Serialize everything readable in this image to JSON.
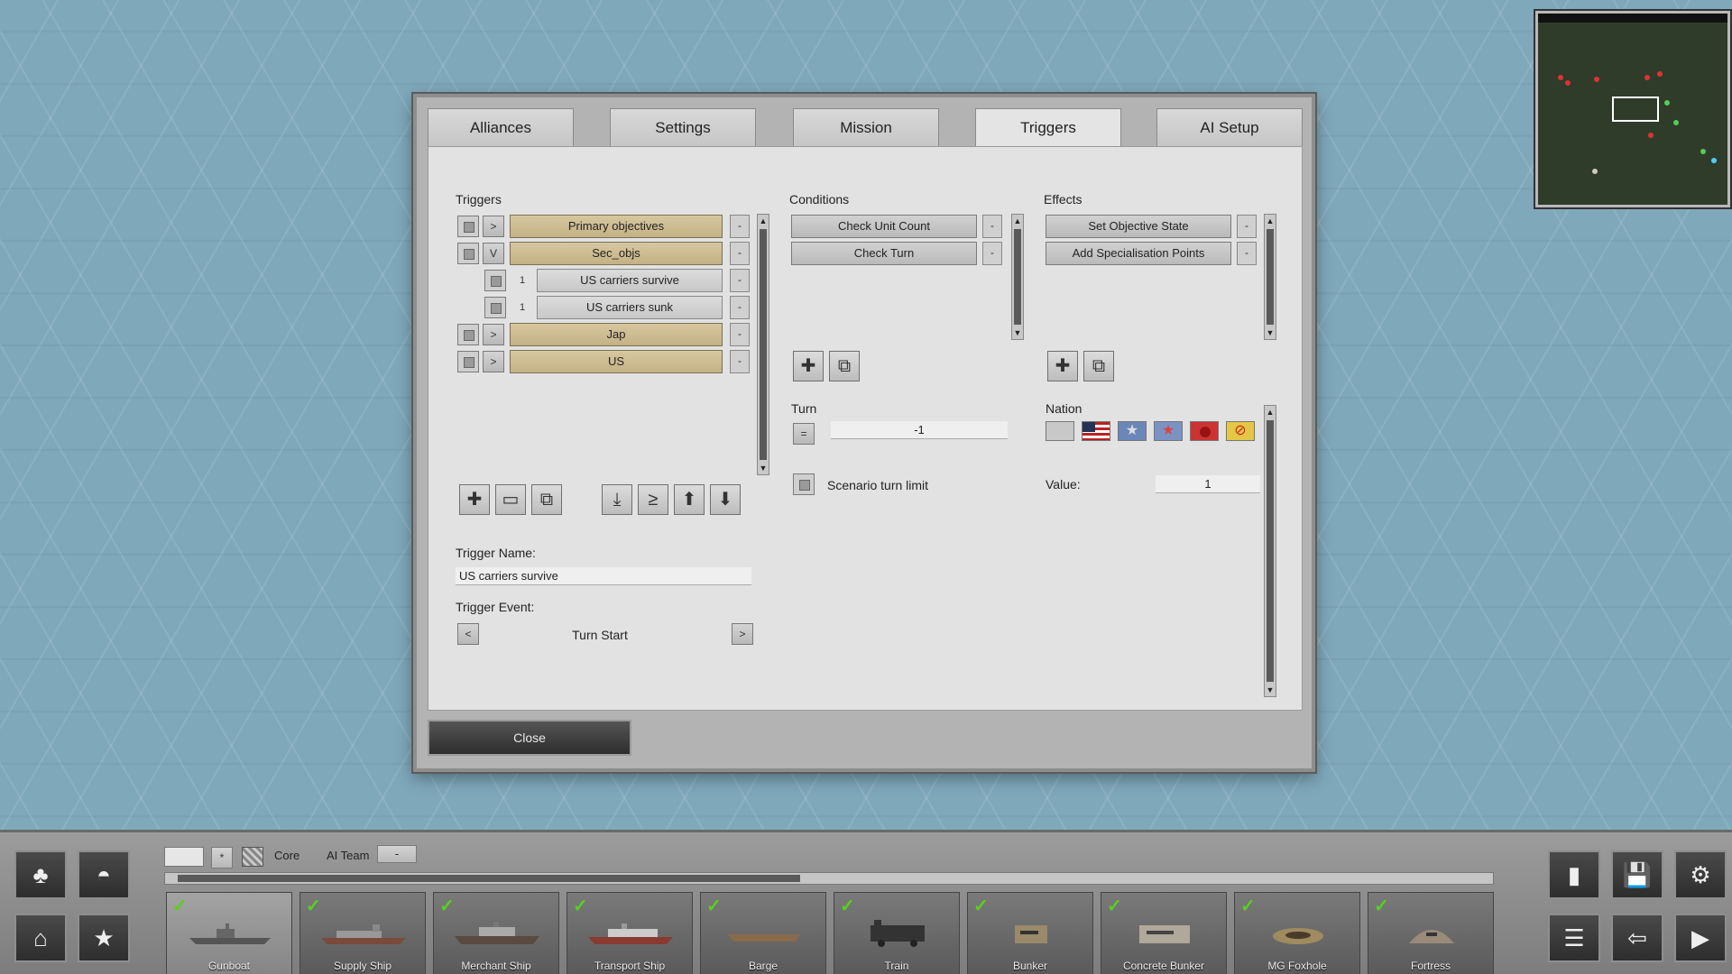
{
  "tabs": [
    {
      "label": "Alliances"
    },
    {
      "label": "Settings"
    },
    {
      "label": "Mission"
    },
    {
      "label": "Triggers",
      "active": true
    },
    {
      "label": "AI Setup"
    }
  ],
  "triggers": {
    "heading": "Triggers",
    "items": [
      {
        "expander": ">",
        "label": "Primary objectives",
        "style": "group"
      },
      {
        "expander": "V",
        "label": "Sec_objs",
        "style": "group"
      },
      {
        "index": "1",
        "label": "US carriers survive",
        "style": "item"
      },
      {
        "index": "1",
        "label": "US carriers sunk",
        "style": "item"
      },
      {
        "expander": ">",
        "label": "Jap",
        "style": "group"
      },
      {
        "expander": ">",
        "label": "US",
        "style": "group"
      }
    ],
    "minus": "-",
    "name_label": "Trigger Name:",
    "name_value": "US carriers survive",
    "event_label": "Trigger Event:",
    "event_value": "Turn Start",
    "event_prev": "<",
    "event_next": ">"
  },
  "conditions": {
    "heading": "Conditions",
    "items": [
      "Check Unit Count",
      "Check Turn"
    ],
    "turn_label": "Turn",
    "turn_operator": "=",
    "turn_value": "-1",
    "scenario_turn_limit": "Scenario turn limit"
  },
  "effects": {
    "heading": "Effects",
    "items": [
      "Set Objective State",
      "Add Specialisation Points"
    ],
    "nation_label": "Nation",
    "nations": [
      "none-flag",
      "us-flag",
      "star-blue-flag",
      "star-red-flag",
      "japan-flag",
      "no-entry-flag"
    ],
    "value_label": "Value:",
    "value": "1"
  },
  "close_label": "Close",
  "bottom": {
    "core_label": "Core",
    "ai_team_label": "AI Team",
    "ai_team_value": "-",
    "star_label": "*",
    "units": [
      {
        "name": "Gunboat",
        "selected": true
      },
      {
        "name": "Supply Ship"
      },
      {
        "name": "Merchant Ship"
      },
      {
        "name": "Transport Ship"
      },
      {
        "name": "Barge"
      },
      {
        "name": "Train"
      },
      {
        "name": "Bunker"
      },
      {
        "name": "Concrete Bunker"
      },
      {
        "name": "MG Foxhole"
      },
      {
        "name": "Fortress"
      }
    ]
  },
  "colors": {
    "map_bg": "#7fa8bb",
    "trigger_group": "#cdbd93",
    "check_green": "#56d21a"
  }
}
